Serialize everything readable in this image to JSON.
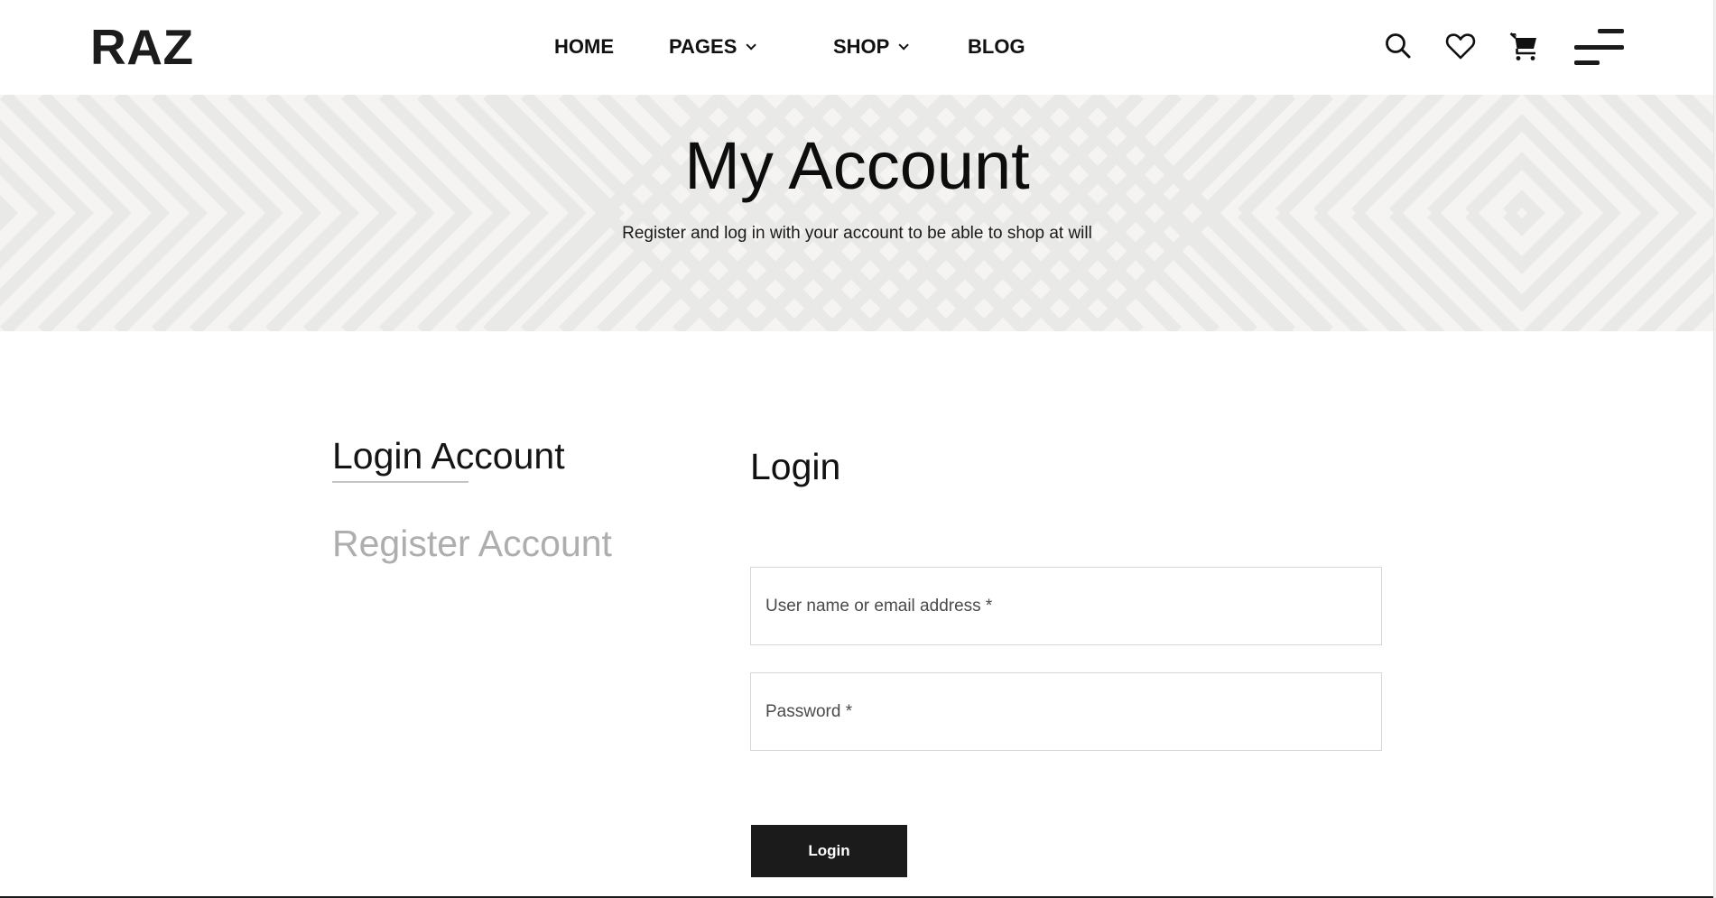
{
  "header": {
    "logo": "RAZ",
    "nav": [
      {
        "label": "HOME",
        "has_dropdown": false
      },
      {
        "label": "PAGES",
        "has_dropdown": true
      },
      {
        "label": "SHOP",
        "has_dropdown": true
      },
      {
        "label": "BLOG",
        "has_dropdown": false
      }
    ],
    "icons": [
      "search-icon",
      "heart-icon",
      "cart-icon",
      "menu-icon"
    ]
  },
  "banner": {
    "title": "My Account",
    "subtitle": "Register and log in with your account to be able to shop at will"
  },
  "account_tabs": {
    "login_label": "Login Account",
    "register_label": "Register Account",
    "active": "Login Account"
  },
  "login_form": {
    "title": "Login",
    "username": {
      "value": "",
      "placeholder": "User name or email address *"
    },
    "password": {
      "value": "",
      "placeholder": "Password *"
    },
    "submit_label": "Login"
  },
  "colors": {
    "text_primary": "#1c1c1c",
    "tab_inactive": "#aeaeae",
    "button_bg": "#1b1b1b",
    "banner_bg": "#f5f4f2",
    "banner_stripe": "#e9e9e7",
    "input_border": "#d6d6d6"
  }
}
